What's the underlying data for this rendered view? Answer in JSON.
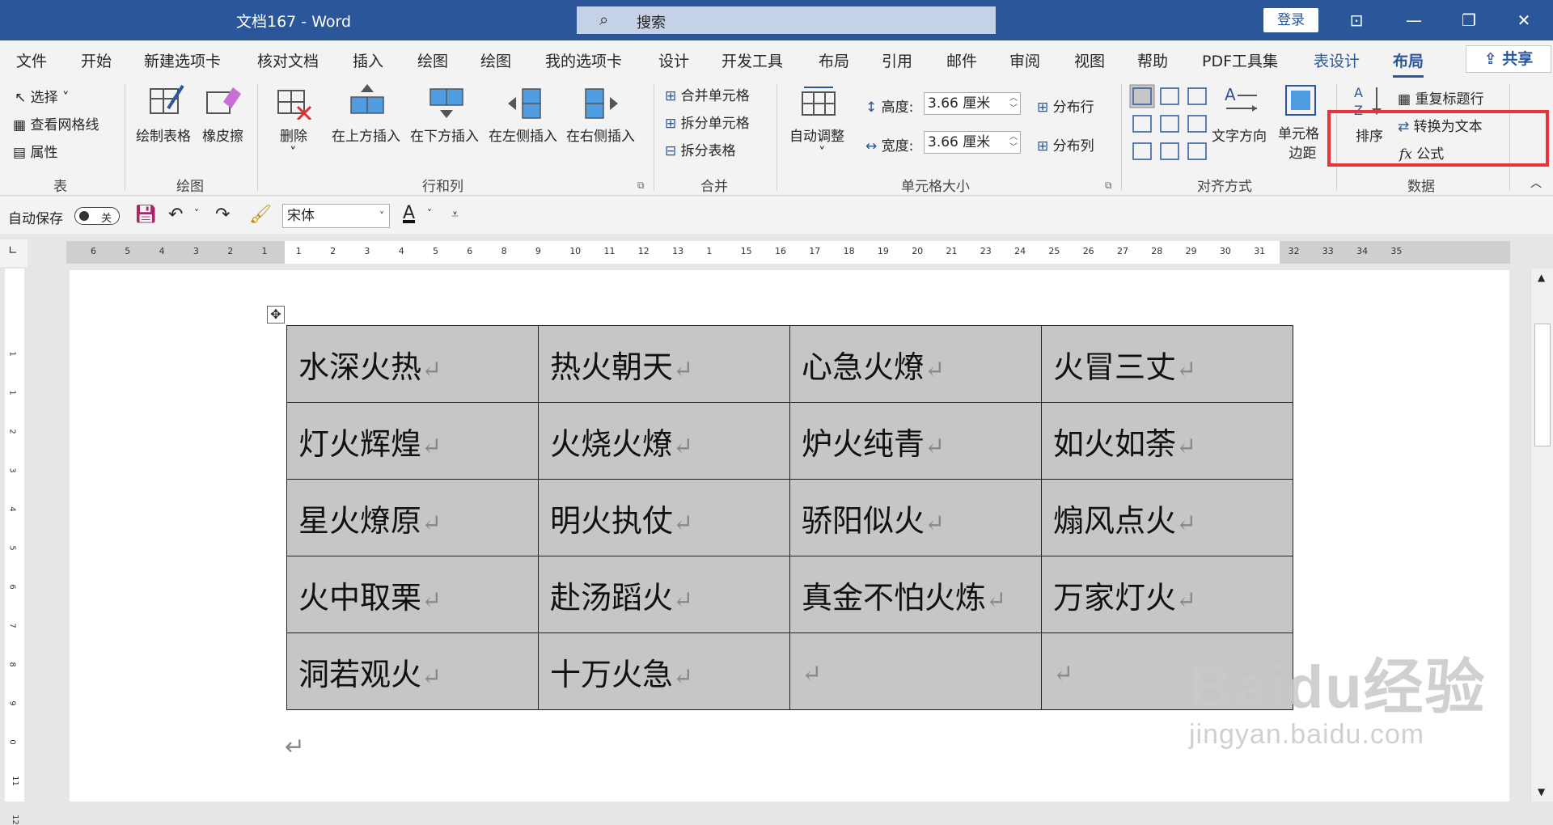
{
  "window": {
    "title": "文档167 - Word",
    "search_placeholder": "搜索",
    "login": "登录"
  },
  "tabs": {
    "file": "文件",
    "home": "开始",
    "new_tab": "新建选项卡",
    "review_doc": "核对文档",
    "insert": "插入",
    "draw1": "绘图",
    "draw2": "绘图",
    "my_tab": "我的选项卡",
    "design": "设计",
    "developer": "开发工具",
    "layout": "布局",
    "references": "引用",
    "mailings": "邮件",
    "review": "审阅",
    "view": "视图",
    "help": "帮助",
    "pdf": "PDF工具集",
    "table_design": "表设计",
    "table_layout": "布局",
    "share": "共享"
  },
  "ribbon": {
    "table": {
      "select": "选择",
      "gridlines": "查看网格线",
      "properties": "属性",
      "label": "表"
    },
    "draw": {
      "draw_table": "绘制表格",
      "eraser": "橡皮擦",
      "label": "绘图"
    },
    "rows_cols": {
      "delete": "删除",
      "insert_above": "在上方插入",
      "insert_below": "在下方插入",
      "insert_left": "在左侧插入",
      "insert_right": "在右侧插入",
      "label": "行和列"
    },
    "merge": {
      "merge_cells": "合并单元格",
      "split_cells": "拆分单元格",
      "split_table": "拆分表格",
      "label": "合并"
    },
    "cell_size": {
      "autofit": "自动调整",
      "height_label": "高度:",
      "height_value": "3.66 厘米",
      "width_label": "宽度:",
      "width_value": "3.66 厘米",
      "distribute_rows": "分布行",
      "distribute_cols": "分布列",
      "label": "单元格大小"
    },
    "alignment": {
      "text_direction": "文字方向",
      "cell_margins_1": "单元格",
      "cell_margins_2": "边距",
      "label": "对齐方式"
    },
    "data": {
      "sort": "排序",
      "repeat_header": "重复标题行",
      "convert_text": "转换为文本",
      "formula": "公式",
      "label": "数据"
    }
  },
  "qat": {
    "autosave": "自动保存",
    "toggle_off": "关",
    "font": "宋体"
  },
  "ruler": {
    "h_ticks": [
      "6",
      "5",
      "4",
      "3",
      "2",
      "1",
      "1",
      "2",
      "3",
      "4",
      "5",
      "6",
      "8",
      "9",
      "10",
      "11",
      "12",
      "13",
      "1",
      "15",
      "16",
      "17",
      "18",
      "19",
      "20",
      "21",
      "23",
      "24",
      "25",
      "26",
      "27",
      "28",
      "29",
      "30",
      "31",
      "32",
      "33",
      "34",
      "35"
    ],
    "v_ticks": [
      "1",
      "1",
      "2",
      "3",
      "4",
      "5",
      "6",
      "7",
      "8",
      "9",
      "0",
      "11",
      "12"
    ]
  },
  "table": {
    "rows": [
      [
        "水深火热",
        "热火朝天",
        "心急火燎",
        "火冒三丈"
      ],
      [
        "灯火辉煌",
        "火烧火燎",
        "炉火纯青",
        "如火如荼"
      ],
      [
        "星火燎原",
        "明火执仗",
        "骄阳似火",
        "煽风点火"
      ],
      [
        "火中取栗",
        "赴汤蹈火",
        "真金不怕火炼",
        "万家灯火"
      ],
      [
        "洞若观火",
        "十万火急",
        "",
        ""
      ]
    ],
    "paragraph_mark": "↵"
  },
  "watermark": {
    "brand": "Baidu经验",
    "url": "jingyan.baidu.com"
  }
}
